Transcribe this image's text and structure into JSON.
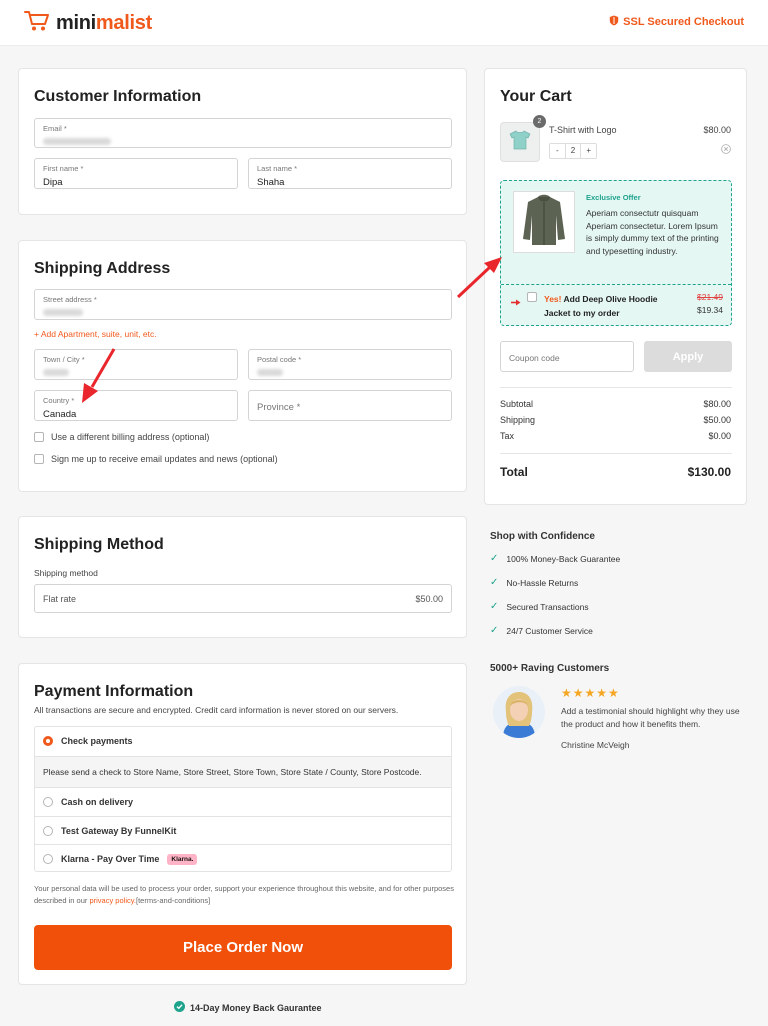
{
  "header": {
    "logo_mini": "mini",
    "logo_malist": "malist",
    "ssl_text": "SSL Secured Checkout"
  },
  "customer": {
    "title": "Customer Information",
    "email_label": "Email *",
    "first_label": "First name *",
    "first_value": "Dipa",
    "last_label": "Last name *",
    "last_value": "Shaha"
  },
  "shipping_address": {
    "title": "Shipping Address",
    "street_label": "Street address *",
    "add_apartment": "+ Add Apartment, suite, unit, etc.",
    "town_label": "Town / City *",
    "postal_label": "Postal code *",
    "country_label": "Country *",
    "country_value": "Canada",
    "province_placeholder": "Province *",
    "billing_check": "Use a different billing address (optional)",
    "signup_check": "Sign me up to receive email updates and news (optional)"
  },
  "shipping_method": {
    "title": "Shipping Method",
    "label": "Shipping method",
    "option": "Flat rate",
    "price": "$50.00"
  },
  "payment": {
    "title": "Payment Information",
    "subtitle": "All transactions are secure and encrypted. Credit card information is never stored on our servers.",
    "check_payments": "Check payments",
    "check_note": "Please send a check to Store Name, Store Street, Store Town, Store State / County, Store Postcode.",
    "cod": "Cash on delivery",
    "test_gateway": "Test Gateway By FunnelKit",
    "klarna": "Klarna - Pay Over Time",
    "klarna_badge": "Klarna.",
    "privacy_text_1": "Your personal data will be used to process your order, support your experience throughout this website, and for other purposes described in our",
    "privacy_link": "privacy policy.",
    "privacy_text_2": "[terms-and-conditions]",
    "place_order": "Place Order Now",
    "guarantee": "14-Day Money Back Gaurantee"
  },
  "cart": {
    "title": "Your Cart",
    "item_name": "T-Shirt with Logo",
    "item_price": "$80.00",
    "item_badge": "2",
    "qty_minus": "-",
    "qty": "2",
    "qty_plus": "+",
    "offer_label": "Exclusive Offer",
    "offer_text": "Aperiam consectutr quisquam Aperiam consectetur. Lorem Ipsum is simply dummy text of the printing and typesetting industry.",
    "offer_yes": "Yes!",
    "offer_add": "Add Deep Olive Hoodie Jacket to my order",
    "offer_old_price": "$21.49",
    "offer_new_price": "$19.34",
    "coupon_placeholder": "Coupon code",
    "apply": "Apply",
    "subtotal_label": "Subtotal",
    "subtotal": "$80.00",
    "shipping_label": "Shipping",
    "shipping": "$50.00",
    "tax_label": "Tax",
    "tax": "$0.00",
    "total_label": "Total",
    "total": "$130.00"
  },
  "confidence": {
    "title": "Shop with Confidence",
    "items": [
      "100% Money-Back Guarantee",
      "No-Hassle Returns",
      "Secured Transactions",
      "24/7 Customer Service"
    ]
  },
  "testimonial": {
    "title": "5000+ Raving Customers",
    "stars": "★★★★★",
    "text": "Add a testimonial should highlight why they use the product and how it benefits them.",
    "author": "Christine McVeigh"
  },
  "colors": {
    "accent": "#f0591c",
    "teal": "#1fa38d",
    "offer_bg": "#e4f7f3"
  }
}
